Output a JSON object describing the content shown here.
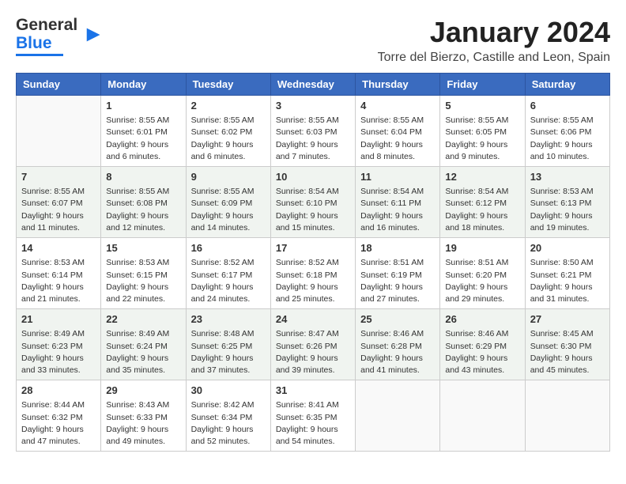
{
  "logo": {
    "line1": "General",
    "line2": "Blue"
  },
  "title": "January 2024",
  "location": "Torre del Bierzo, Castille and Leon, Spain",
  "weekdays": [
    "Sunday",
    "Monday",
    "Tuesday",
    "Wednesday",
    "Thursday",
    "Friday",
    "Saturday"
  ],
  "weeks": [
    [
      {
        "day": "",
        "detail": ""
      },
      {
        "day": "1",
        "detail": "Sunrise: 8:55 AM\nSunset: 6:01 PM\nDaylight: 9 hours\nand 6 minutes."
      },
      {
        "day": "2",
        "detail": "Sunrise: 8:55 AM\nSunset: 6:02 PM\nDaylight: 9 hours\nand 6 minutes."
      },
      {
        "day": "3",
        "detail": "Sunrise: 8:55 AM\nSunset: 6:03 PM\nDaylight: 9 hours\nand 7 minutes."
      },
      {
        "day": "4",
        "detail": "Sunrise: 8:55 AM\nSunset: 6:04 PM\nDaylight: 9 hours\nand 8 minutes."
      },
      {
        "day": "5",
        "detail": "Sunrise: 8:55 AM\nSunset: 6:05 PM\nDaylight: 9 hours\nand 9 minutes."
      },
      {
        "day": "6",
        "detail": "Sunrise: 8:55 AM\nSunset: 6:06 PM\nDaylight: 9 hours\nand 10 minutes."
      }
    ],
    [
      {
        "day": "7",
        "detail": "Sunrise: 8:55 AM\nSunset: 6:07 PM\nDaylight: 9 hours\nand 11 minutes."
      },
      {
        "day": "8",
        "detail": "Sunrise: 8:55 AM\nSunset: 6:08 PM\nDaylight: 9 hours\nand 12 minutes."
      },
      {
        "day": "9",
        "detail": "Sunrise: 8:55 AM\nSunset: 6:09 PM\nDaylight: 9 hours\nand 14 minutes."
      },
      {
        "day": "10",
        "detail": "Sunrise: 8:54 AM\nSunset: 6:10 PM\nDaylight: 9 hours\nand 15 minutes."
      },
      {
        "day": "11",
        "detail": "Sunrise: 8:54 AM\nSunset: 6:11 PM\nDaylight: 9 hours\nand 16 minutes."
      },
      {
        "day": "12",
        "detail": "Sunrise: 8:54 AM\nSunset: 6:12 PM\nDaylight: 9 hours\nand 18 minutes."
      },
      {
        "day": "13",
        "detail": "Sunrise: 8:53 AM\nSunset: 6:13 PM\nDaylight: 9 hours\nand 19 minutes."
      }
    ],
    [
      {
        "day": "14",
        "detail": "Sunrise: 8:53 AM\nSunset: 6:14 PM\nDaylight: 9 hours\nand 21 minutes."
      },
      {
        "day": "15",
        "detail": "Sunrise: 8:53 AM\nSunset: 6:15 PM\nDaylight: 9 hours\nand 22 minutes."
      },
      {
        "day": "16",
        "detail": "Sunrise: 8:52 AM\nSunset: 6:17 PM\nDaylight: 9 hours\nand 24 minutes."
      },
      {
        "day": "17",
        "detail": "Sunrise: 8:52 AM\nSunset: 6:18 PM\nDaylight: 9 hours\nand 25 minutes."
      },
      {
        "day": "18",
        "detail": "Sunrise: 8:51 AM\nSunset: 6:19 PM\nDaylight: 9 hours\nand 27 minutes."
      },
      {
        "day": "19",
        "detail": "Sunrise: 8:51 AM\nSunset: 6:20 PM\nDaylight: 9 hours\nand 29 minutes."
      },
      {
        "day": "20",
        "detail": "Sunrise: 8:50 AM\nSunset: 6:21 PM\nDaylight: 9 hours\nand 31 minutes."
      }
    ],
    [
      {
        "day": "21",
        "detail": "Sunrise: 8:49 AM\nSunset: 6:23 PM\nDaylight: 9 hours\nand 33 minutes."
      },
      {
        "day": "22",
        "detail": "Sunrise: 8:49 AM\nSunset: 6:24 PM\nDaylight: 9 hours\nand 35 minutes."
      },
      {
        "day": "23",
        "detail": "Sunrise: 8:48 AM\nSunset: 6:25 PM\nDaylight: 9 hours\nand 37 minutes."
      },
      {
        "day": "24",
        "detail": "Sunrise: 8:47 AM\nSunset: 6:26 PM\nDaylight: 9 hours\nand 39 minutes."
      },
      {
        "day": "25",
        "detail": "Sunrise: 8:46 AM\nSunset: 6:28 PM\nDaylight: 9 hours\nand 41 minutes."
      },
      {
        "day": "26",
        "detail": "Sunrise: 8:46 AM\nSunset: 6:29 PM\nDaylight: 9 hours\nand 43 minutes."
      },
      {
        "day": "27",
        "detail": "Sunrise: 8:45 AM\nSunset: 6:30 PM\nDaylight: 9 hours\nand 45 minutes."
      }
    ],
    [
      {
        "day": "28",
        "detail": "Sunrise: 8:44 AM\nSunset: 6:32 PM\nDaylight: 9 hours\nand 47 minutes."
      },
      {
        "day": "29",
        "detail": "Sunrise: 8:43 AM\nSunset: 6:33 PM\nDaylight: 9 hours\nand 49 minutes."
      },
      {
        "day": "30",
        "detail": "Sunrise: 8:42 AM\nSunset: 6:34 PM\nDaylight: 9 hours\nand 52 minutes."
      },
      {
        "day": "31",
        "detail": "Sunrise: 8:41 AM\nSunset: 6:35 PM\nDaylight: 9 hours\nand 54 minutes."
      },
      {
        "day": "",
        "detail": ""
      },
      {
        "day": "",
        "detail": ""
      },
      {
        "day": "",
        "detail": ""
      }
    ]
  ]
}
